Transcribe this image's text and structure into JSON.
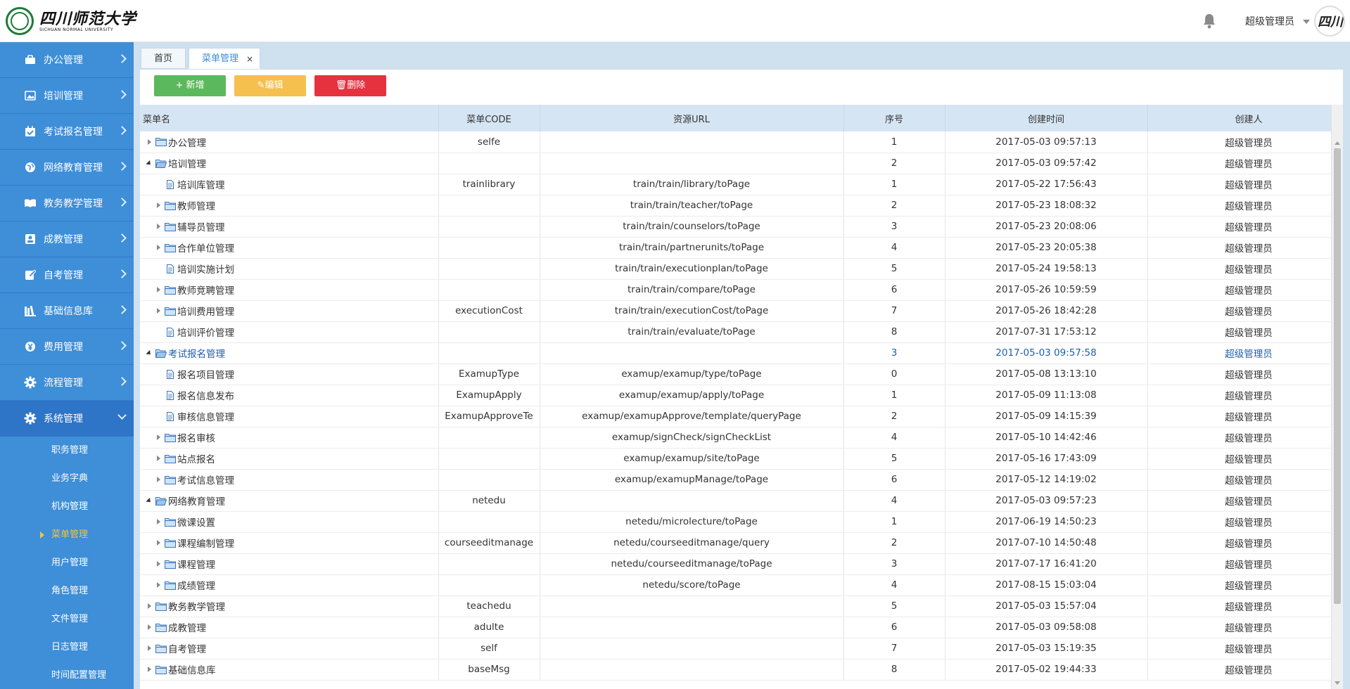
{
  "header": {
    "logo_cn": "四川师范大学",
    "logo_en": "SICHUAN NORMAL UNIVERSITY",
    "user_name": "超级管理员",
    "avatar_text": "四川师"
  },
  "sidebar": {
    "menus": [
      {
        "label": "办公管理",
        "icon": "briefcase-icon"
      },
      {
        "label": "培训管理",
        "icon": "image-icon"
      },
      {
        "label": "考试报名管理",
        "icon": "calendar-check-icon"
      },
      {
        "label": "网络教育管理",
        "icon": "globe-icon"
      },
      {
        "label": "教务教学管理",
        "icon": "book-icon"
      },
      {
        "label": "成教管理",
        "icon": "id-card-icon"
      },
      {
        "label": "自考管理",
        "icon": "edit-icon"
      },
      {
        "label": "基础信息库",
        "icon": "library-icon"
      },
      {
        "label": "费用管理",
        "icon": "yen-icon"
      },
      {
        "label": "流程管理",
        "icon": "gear-icon"
      },
      {
        "label": "系统管理",
        "icon": "gear-icon"
      }
    ],
    "submenu": [
      "职务管理",
      "业务字典",
      "机构管理",
      "菜单管理",
      "用户管理",
      "角色管理",
      "文件管理",
      "日志管理",
      "时间配置管理"
    ]
  },
  "tabs": [
    {
      "label": "首页"
    },
    {
      "label": "菜单管理",
      "close": "×"
    }
  ],
  "toolbar": {
    "add_label": "新增",
    "edit_label": "编辑",
    "delete_label": "删除"
  },
  "table": {
    "columns": [
      "菜单名",
      "菜单CODE",
      "资源URL",
      "序号",
      "创建时间",
      "创建人"
    ],
    "rows": [
      {
        "name": "办公管理",
        "level": 0,
        "toggle": "collapsed",
        "icon": "folder",
        "code": "selfe",
        "url": "",
        "order": "1",
        "time": "2017-05-03 09:57:13",
        "creator": "超级管理员"
      },
      {
        "name": "培训管理",
        "level": 0,
        "toggle": "expanded",
        "icon": "folder-open",
        "code": "",
        "url": "",
        "order": "2",
        "time": "2017-05-03 09:57:42",
        "creator": "超级管理员"
      },
      {
        "name": "培训库管理",
        "level": 1,
        "toggle": "none",
        "icon": "file",
        "code": "trainlibrary",
        "url": "train/train/library/toPage",
        "order": "1",
        "time": "2017-05-22 17:56:43",
        "creator": "超级管理员"
      },
      {
        "name": "教师管理",
        "level": 1,
        "toggle": "collapsed",
        "icon": "folder",
        "code": "",
        "url": "train/train/teacher/toPage",
        "order": "2",
        "time": "2017-05-23 18:08:32",
        "creator": "超级管理员"
      },
      {
        "name": "辅导员管理",
        "level": 1,
        "toggle": "collapsed",
        "icon": "folder",
        "code": "",
        "url": "train/train/counselors/toPage",
        "order": "3",
        "time": "2017-05-23 20:08:06",
        "creator": "超级管理员"
      },
      {
        "name": "合作单位管理",
        "level": 1,
        "toggle": "collapsed",
        "icon": "folder",
        "code": "",
        "url": "train/train/partnerunits/toPage",
        "order": "4",
        "time": "2017-05-23 20:05:38",
        "creator": "超级管理员"
      },
      {
        "name": "培训实施计划",
        "level": 1,
        "toggle": "none",
        "icon": "file",
        "code": "",
        "url": "train/train/executionplan/toPage",
        "order": "5",
        "time": "2017-05-24 19:58:13",
        "creator": "超级管理员"
      },
      {
        "name": "教师竞聘管理",
        "level": 1,
        "toggle": "collapsed",
        "icon": "folder",
        "code": "",
        "url": "train/train/compare/toPage",
        "order": "6",
        "time": "2017-05-26 10:59:59",
        "creator": "超级管理员"
      },
      {
        "name": "培训费用管理",
        "level": 1,
        "toggle": "collapsed",
        "icon": "folder",
        "code": "executionCost",
        "url": "train/train/executionCost/toPage",
        "order": "7",
        "time": "2017-05-26 18:42:28",
        "creator": "超级管理员"
      },
      {
        "name": "培训评价管理",
        "level": 1,
        "toggle": "none",
        "icon": "file",
        "code": "",
        "url": "train/train/evaluate/toPage",
        "order": "8",
        "time": "2017-07-31 17:53:12",
        "creator": "超级管理员"
      },
      {
        "name": "考试报名管理",
        "level": 0,
        "toggle": "expanded",
        "icon": "folder-open",
        "code": "",
        "url": "",
        "order": "3",
        "time": "2017-05-03 09:57:58",
        "creator": "超级管理员",
        "highlight": true
      },
      {
        "name": "报名项目管理",
        "level": 1,
        "toggle": "none",
        "icon": "file",
        "code": "ExamupType",
        "url": "examup/examup/type/toPage",
        "order": "0",
        "time": "2017-05-08 13:13:10",
        "creator": "超级管理员"
      },
      {
        "name": "报名信息发布",
        "level": 1,
        "toggle": "none",
        "icon": "file",
        "code": "ExamupApply",
        "url": "examup/examup/apply/toPage",
        "order": "1",
        "time": "2017-05-09 11:13:08",
        "creator": "超级管理员"
      },
      {
        "name": "审核信息管理",
        "level": 1,
        "toggle": "none",
        "icon": "file",
        "code": "ExamupApproveTe",
        "url": "examup/examupApprove/template/queryPage",
        "order": "2",
        "time": "2017-05-09 14:15:39",
        "creator": "超级管理员"
      },
      {
        "name": "报名审核",
        "level": 1,
        "toggle": "collapsed",
        "icon": "folder",
        "code": "",
        "url": "examup/signCheck/signCheckList",
        "order": "4",
        "time": "2017-05-10 14:42:46",
        "creator": "超级管理员"
      },
      {
        "name": "站点报名",
        "level": 1,
        "toggle": "collapsed",
        "icon": "folder",
        "code": "",
        "url": "examup/examup/site/toPage",
        "order": "5",
        "time": "2017-05-16 17:43:09",
        "creator": "超级管理员"
      },
      {
        "name": "考试信息管理",
        "level": 1,
        "toggle": "collapsed",
        "icon": "folder",
        "code": "",
        "url": "examup/examupManage/toPage",
        "order": "6",
        "time": "2017-05-12 14:19:02",
        "creator": "超级管理员"
      },
      {
        "name": "网络教育管理",
        "level": 0,
        "toggle": "expanded",
        "icon": "folder-open",
        "code": "netedu",
        "url": "",
        "order": "4",
        "time": "2017-05-03 09:57:23",
        "creator": "超级管理员"
      },
      {
        "name": "微课设置",
        "level": 1,
        "toggle": "collapsed",
        "icon": "folder",
        "code": "",
        "url": "netedu/microlecture/toPage",
        "order": "1",
        "time": "2017-06-19 14:50:23",
        "creator": "超级管理员"
      },
      {
        "name": "课程编制管理",
        "level": 1,
        "toggle": "collapsed",
        "icon": "folder",
        "code": "courseeditmanage",
        "url": "netedu/courseeditmanage/query",
        "order": "2",
        "time": "2017-07-10 14:50:48",
        "creator": "超级管理员"
      },
      {
        "name": "课程管理",
        "level": 1,
        "toggle": "collapsed",
        "icon": "folder",
        "code": "",
        "url": "netedu/courseeditmanage/toPage",
        "order": "3",
        "time": "2017-07-17 16:41:20",
        "creator": "超级管理员"
      },
      {
        "name": "成绩管理",
        "level": 1,
        "toggle": "collapsed",
        "icon": "folder",
        "code": "",
        "url": "netedu/score/toPage",
        "order": "4",
        "time": "2017-08-15 15:03:04",
        "creator": "超级管理员"
      },
      {
        "name": "教务教学管理",
        "level": 0,
        "toggle": "collapsed",
        "icon": "folder",
        "code": "teachedu",
        "url": "",
        "order": "5",
        "time": "2017-05-03 15:57:04",
        "creator": "超级管理员"
      },
      {
        "name": "成教管理",
        "level": 0,
        "toggle": "collapsed",
        "icon": "folder",
        "code": "adulte",
        "url": "",
        "order": "6",
        "time": "2017-05-03 09:58:08",
        "creator": "超级管理员"
      },
      {
        "name": "自考管理",
        "level": 0,
        "toggle": "collapsed",
        "icon": "folder",
        "code": "self",
        "url": "",
        "order": "7",
        "time": "2017-05-03 15:19:35",
        "creator": "超级管理员"
      },
      {
        "name": "基础信息库",
        "level": 0,
        "toggle": "collapsed",
        "icon": "folder",
        "code": "baseMsg",
        "url": "",
        "order": "8",
        "time": "2017-05-02 19:44:33",
        "creator": "超级管理员"
      }
    ]
  },
  "colors": {
    "sidebar_bg": "#3e8ed8",
    "active_menu_bg": "#2e74c7",
    "current_sub": "#f5c33b",
    "add_button": "#5cb85c",
    "edit_button": "#f5c04f",
    "delete_button": "#e5323e",
    "highlight_text": "#1e5faa"
  }
}
